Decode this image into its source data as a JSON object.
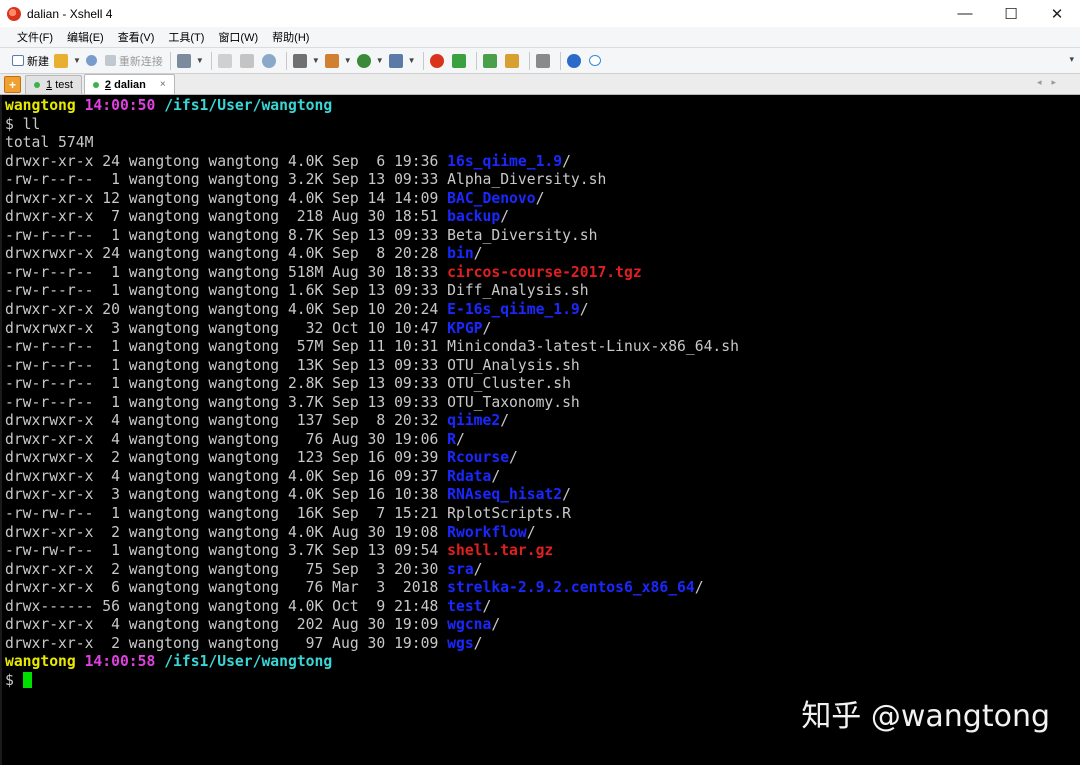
{
  "window": {
    "title": "dalian - Xshell 4",
    "controls": {
      "minimize": "—",
      "maximize": "☐",
      "close": "✕"
    }
  },
  "menu": [
    "文件(F)",
    "编辑(E)",
    "查看(V)",
    "工具(T)",
    "窗口(W)",
    "帮助(H)"
  ],
  "toolbar": {
    "new_label": "新建",
    "reconnect_label": "重新连接",
    "icons": [
      {
        "name": "open-folder",
        "color": "#e8b030"
      },
      {
        "name": "disconnect",
        "color": "#7a9ccc"
      },
      {
        "name": "properties",
        "color": "#7c8a9e"
      },
      {
        "name": "copy",
        "color": "#b8b8b8"
      },
      {
        "name": "paste",
        "color": "#b8b8b8"
      },
      {
        "name": "find",
        "color": "#8aa8c8"
      },
      {
        "name": "print",
        "color": "#707070"
      },
      {
        "name": "transfer",
        "color": "#d08030"
      },
      {
        "name": "globe",
        "color": "#3a8a3a"
      },
      {
        "name": "keymap",
        "color": "#5a7aa8"
      },
      {
        "name": "xshell",
        "color": "#d8341c"
      },
      {
        "name": "xftp",
        "color": "#3aa040"
      },
      {
        "name": "layout",
        "color": "#4aa04a"
      },
      {
        "name": "lock",
        "color": "#d8a030"
      },
      {
        "name": "keyboard",
        "color": "#8a8a8a"
      },
      {
        "name": "help",
        "color": "#2a6ac8"
      },
      {
        "name": "chat",
        "color": "#3a8ad8"
      }
    ]
  },
  "tabs": [
    {
      "number": "1",
      "label": "test",
      "active": false
    },
    {
      "number": "2",
      "label": "dalian",
      "active": true
    }
  ],
  "tab_close": "×",
  "terminal": {
    "prompt1": {
      "user": "wangtong",
      "time": "14:00:50",
      "path": "/ifs1/User/wangtong"
    },
    "command": "$ ll",
    "total": "total 574M",
    "entries": [
      {
        "meta": "drwxr-xr-x 24 wangtong wangtong 4.0K Sep  6 19:36 ",
        "name": "16s_qiime_1.9",
        "type": "dir"
      },
      {
        "meta": "-rw-r--r--  1 wangtong wangtong 3.2K Sep 13 09:33 ",
        "name": "Alpha_Diversity.sh",
        "type": "file"
      },
      {
        "meta": "drwxr-xr-x 12 wangtong wangtong 4.0K Sep 14 14:09 ",
        "name": "BAC_Denovo",
        "type": "dir"
      },
      {
        "meta": "drwxr-xr-x  7 wangtong wangtong  218 Aug 30 18:51 ",
        "name": "backup",
        "type": "dir"
      },
      {
        "meta": "-rw-r--r--  1 wangtong wangtong 8.7K Sep 13 09:33 ",
        "name": "Beta_Diversity.sh",
        "type": "file"
      },
      {
        "meta": "drwxrwxr-x 24 wangtong wangtong 4.0K Sep  8 20:28 ",
        "name": "bin",
        "type": "dir"
      },
      {
        "meta": "-rw-r--r--  1 wangtong wangtong 518M Aug 30 18:33 ",
        "name": "circos-course-2017.tgz",
        "type": "archive"
      },
      {
        "meta": "-rw-r--r--  1 wangtong wangtong 1.6K Sep 13 09:33 ",
        "name": "Diff_Analysis.sh",
        "type": "file"
      },
      {
        "meta": "drwxr-xr-x 20 wangtong wangtong 4.0K Sep 10 20:24 ",
        "name": "E-16s_qiime_1.9",
        "type": "dir"
      },
      {
        "meta": "drwxrwxr-x  3 wangtong wangtong   32 Oct 10 10:47 ",
        "name": "KPGP",
        "type": "dir"
      },
      {
        "meta": "-rw-r--r--  1 wangtong wangtong  57M Sep 11 10:31 ",
        "name": "Miniconda3-latest-Linux-x86_64.sh",
        "type": "file"
      },
      {
        "meta": "-rw-r--r--  1 wangtong wangtong  13K Sep 13 09:33 ",
        "name": "OTU_Analysis.sh",
        "type": "file"
      },
      {
        "meta": "-rw-r--r--  1 wangtong wangtong 2.8K Sep 13 09:33 ",
        "name": "OTU_Cluster.sh",
        "type": "file"
      },
      {
        "meta": "-rw-r--r--  1 wangtong wangtong 3.7K Sep 13 09:33 ",
        "name": "OTU_Taxonomy.sh",
        "type": "file"
      },
      {
        "meta": "drwxrwxr-x  4 wangtong wangtong  137 Sep  8 20:32 ",
        "name": "qiime2",
        "type": "dir"
      },
      {
        "meta": "drwxr-xr-x  4 wangtong wangtong   76 Aug 30 19:06 ",
        "name": "R",
        "type": "dir"
      },
      {
        "meta": "drwxrwxr-x  2 wangtong wangtong  123 Sep 16 09:39 ",
        "name": "Rcourse",
        "type": "dir"
      },
      {
        "meta": "drwxrwxr-x  4 wangtong wangtong 4.0K Sep 16 09:37 ",
        "name": "Rdata",
        "type": "dir"
      },
      {
        "meta": "drwxr-xr-x  3 wangtong wangtong 4.0K Sep 16 10:38 ",
        "name": "RNAseq_hisat2",
        "type": "dir"
      },
      {
        "meta": "-rw-rw-r--  1 wangtong wangtong  16K Sep  7 15:21 ",
        "name": "RplotScripts.R",
        "type": "file"
      },
      {
        "meta": "drwxr-xr-x  2 wangtong wangtong 4.0K Aug 30 19:08 ",
        "name": "Rworkflow",
        "type": "dir"
      },
      {
        "meta": "-rw-rw-r--  1 wangtong wangtong 3.7K Sep 13 09:54 ",
        "name": "shell.tar.gz",
        "type": "archive"
      },
      {
        "meta": "drwxr-xr-x  2 wangtong wangtong   75 Sep  3 20:30 ",
        "name": "sra",
        "type": "dir"
      },
      {
        "meta": "drwxr-xr-x  6 wangtong wangtong   76 Mar  3  2018 ",
        "name": "strelka-2.9.2.centos6_x86_64",
        "type": "dir"
      },
      {
        "meta": "drwx------ 56 wangtong wangtong 4.0K Oct  9 21:48 ",
        "name": "test",
        "type": "dir"
      },
      {
        "meta": "drwxr-xr-x  4 wangtong wangtong  202 Aug 30 19:09 ",
        "name": "wgcna",
        "type": "dir"
      },
      {
        "meta": "drwxr-xr-x  2 wangtong wangtong   97 Aug 30 19:09 ",
        "name": "wgs",
        "type": "dir"
      }
    ],
    "prompt2": {
      "user": "wangtong",
      "time": "14:00:58",
      "path": "/ifs1/User/wangtong"
    },
    "input_prompt": "$ "
  },
  "watermark": "知乎 @wangtong",
  "colors": {
    "user": "#e9e900",
    "time": "#e040e0",
    "path": "#3ad6d6",
    "directory": "#1a28ff",
    "archive": "#e02020",
    "cursor": "#00e000"
  }
}
